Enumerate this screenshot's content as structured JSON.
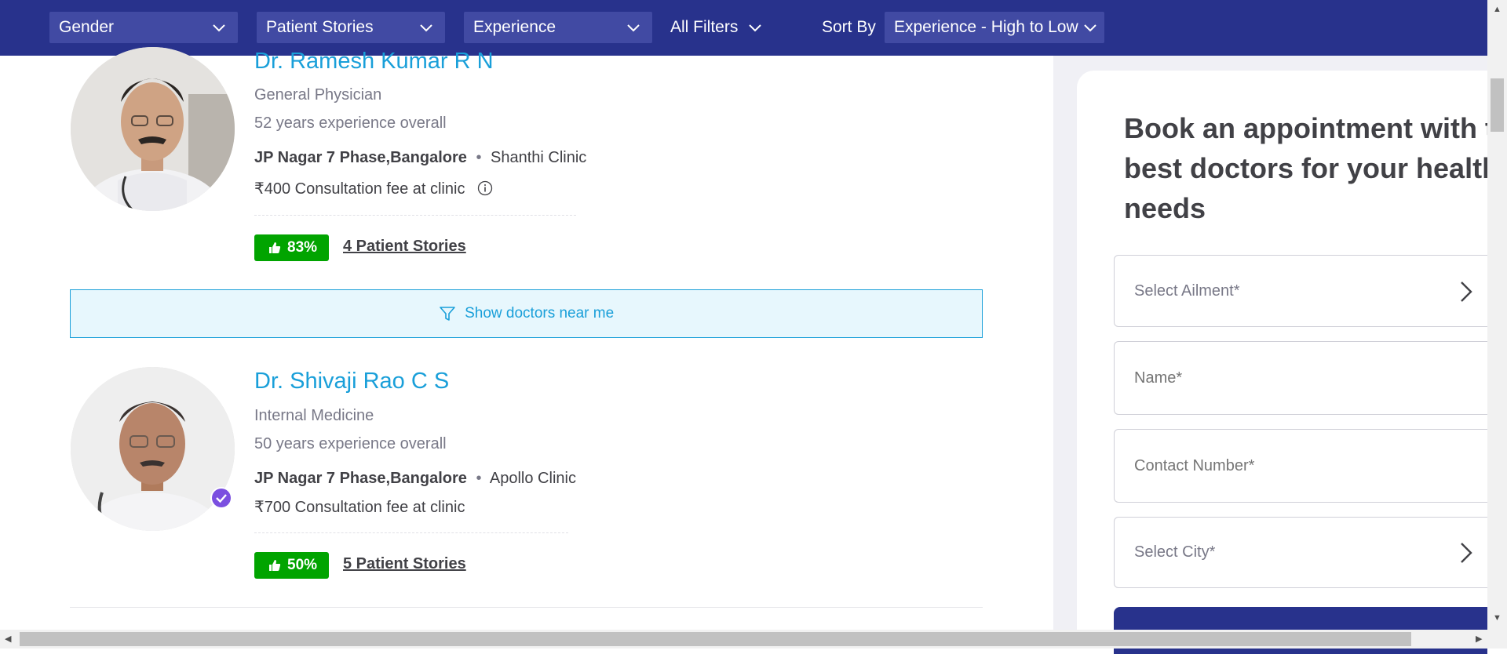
{
  "filters": {
    "gender": "Gender",
    "patient_stories": "Patient Stories",
    "experience": "Experience",
    "all_filters": "All Filters",
    "sort_by_label": "Sort By",
    "sort_by_value": "Experience - High to Low"
  },
  "doctors": [
    {
      "name": "Dr. Ramesh Kumar R N",
      "specialty": "General Physician",
      "experience": "52 years experience overall",
      "location": "JP Nagar 7 Phase,Bangalore",
      "clinic": "Shanthi Clinic",
      "fee": "₹400 Consultation fee at clinic",
      "rating": "83%",
      "stories": "4 Patient Stories"
    },
    {
      "name": "Dr. Shivaji Rao C S",
      "specialty": "Internal Medicine",
      "experience": "50 years experience overall",
      "location": "JP Nagar 7 Phase,Bangalore",
      "clinic": "Apollo Clinic",
      "fee": "₹700 Consultation fee at clinic",
      "rating": "50%",
      "stories": "5 Patient Stories"
    }
  ],
  "near_me": "Show doctors near me",
  "booking": {
    "title_line1": "Book an appointment with th",
    "title_line2": "best doctors for your health",
    "title_line3": "needs",
    "ailment_placeholder": "Select Ailment*",
    "name_placeholder": "Name*",
    "contact_placeholder": "Contact Number*",
    "city_placeholder": "Select City*"
  },
  "colors": {
    "topbar": "#28328c",
    "link": "#199fd9",
    "badge": "#01a400",
    "verified": "#7b4fe0"
  }
}
